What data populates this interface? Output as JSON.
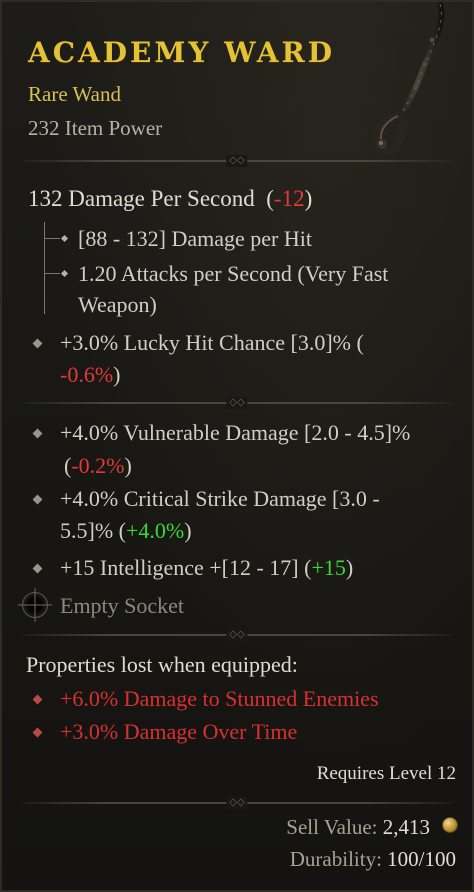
{
  "item": {
    "name": "ACADEMY WARD",
    "rarity": "Rare Wand",
    "item_power": "232 Item Power",
    "image_icon": "wand-icon"
  },
  "dps": {
    "label": "132 Damage Per Second",
    "open": "(",
    "delta": "-12",
    "close": ")"
  },
  "weapon_stats": {
    "damage_per_hit": "[88 - 132] Damage per Hit",
    "attack_speed_line1": "1.20 Attacks per Second (Very Fast",
    "attack_speed_line2": "Weapon)"
  },
  "implicit": {
    "line1": "+3.0% Lucky Hit Chance [3.0]% (",
    "line2_delta": "-0.6%",
    "line2_close": ")"
  },
  "affixes": [
    {
      "line1": "+4.0% Vulnerable Damage [2.0 - 4.5]%",
      "line2_open": "(",
      "delta": "-0.2%",
      "line2_close": ")"
    },
    {
      "line1": "+4.0% Critical Strike Damage [3.0 -",
      "line2_prefix": "5.5]% (",
      "delta": "+4.0%",
      "line2_close": ")"
    },
    {
      "line1_prefix": "+15 Intelligence +[12 - 17] (",
      "delta": "+15",
      "line1_close": ")"
    }
  ],
  "socket": {
    "label": "Empty Socket",
    "icon": "socket-icon"
  },
  "lost_properties": {
    "heading": "Properties lost when equipped:",
    "items": [
      "+6.0% Damage to Stunned Enemies",
      "+3.0% Damage Over Time"
    ]
  },
  "requirements": {
    "level": "Requires Level 12"
  },
  "footer": {
    "sell_label": "Sell Value:",
    "sell_value": "2,413",
    "sell_icon": "gold-coin-icon",
    "durability_label": "Durability:",
    "durability_value": "100/100"
  },
  "colors": {
    "name": "#e4c234",
    "negative": "#e23a3a",
    "positive": "#36d936",
    "lost": "#d83030"
  }
}
